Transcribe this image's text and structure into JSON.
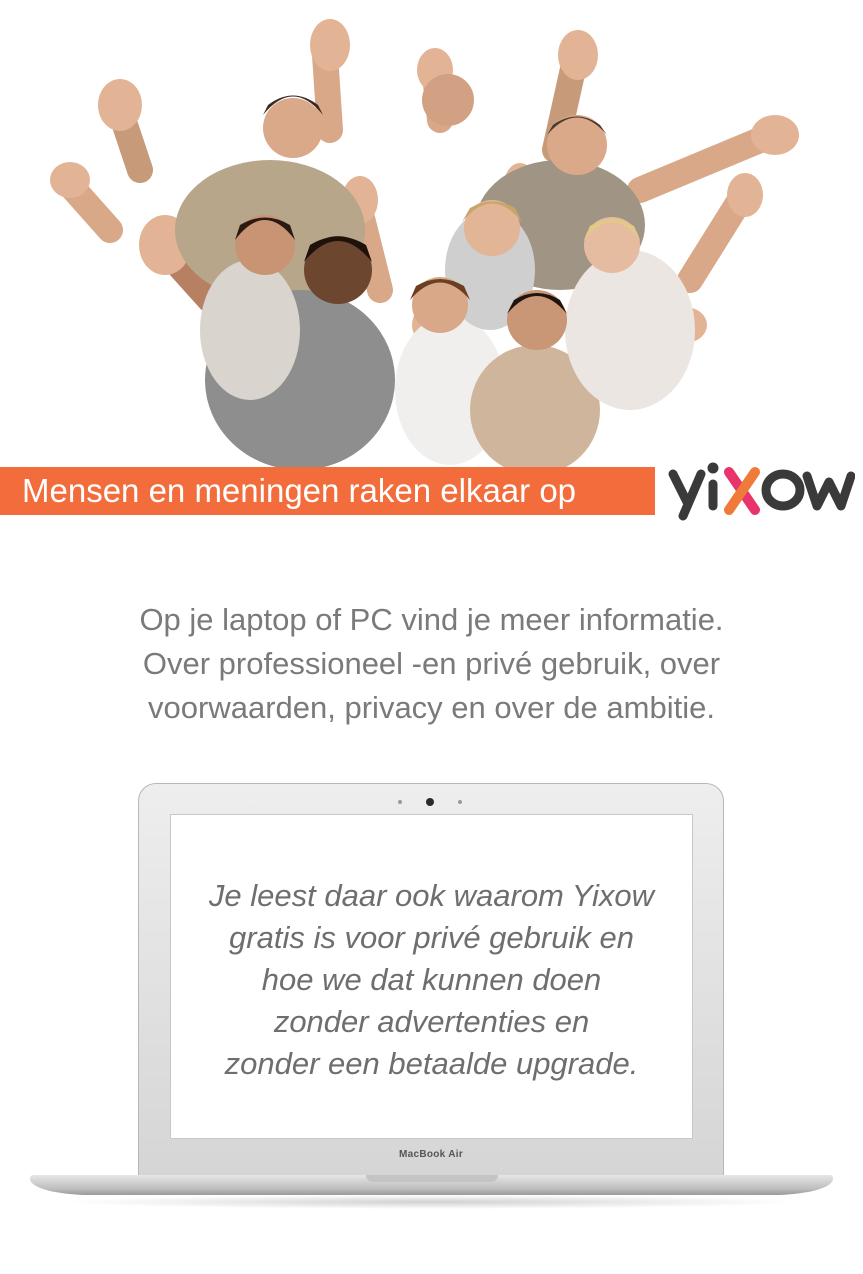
{
  "banner": {
    "tagline": "Mensen en meningen raken elkaar op",
    "logo_text": "yixow",
    "color": "#f26c3c"
  },
  "info": {
    "lines": [
      "Op je laptop of PC vind je meer informatie.",
      "Over professioneel -en privé gebruik, over",
      "voorwaarden, privacy en over de ambitie."
    ]
  },
  "laptop": {
    "model_label": "MacBook Air",
    "screen_lines": [
      "Je leest daar ook waarom Yixow",
      "gratis is voor privé gebruik en",
      "hoe we dat kunnen doen",
      "zonder advertenties en",
      "zonder een betaalde upgrade."
    ]
  },
  "colors": {
    "accent": "#f26c3c",
    "logo_dark": "#3a3a3a",
    "logo_pink": "#e8336b",
    "text_gray": "#7a7a7a"
  },
  "icons": [
    "group-of-people-photo",
    "yixow-logo",
    "laptop-camera"
  ]
}
